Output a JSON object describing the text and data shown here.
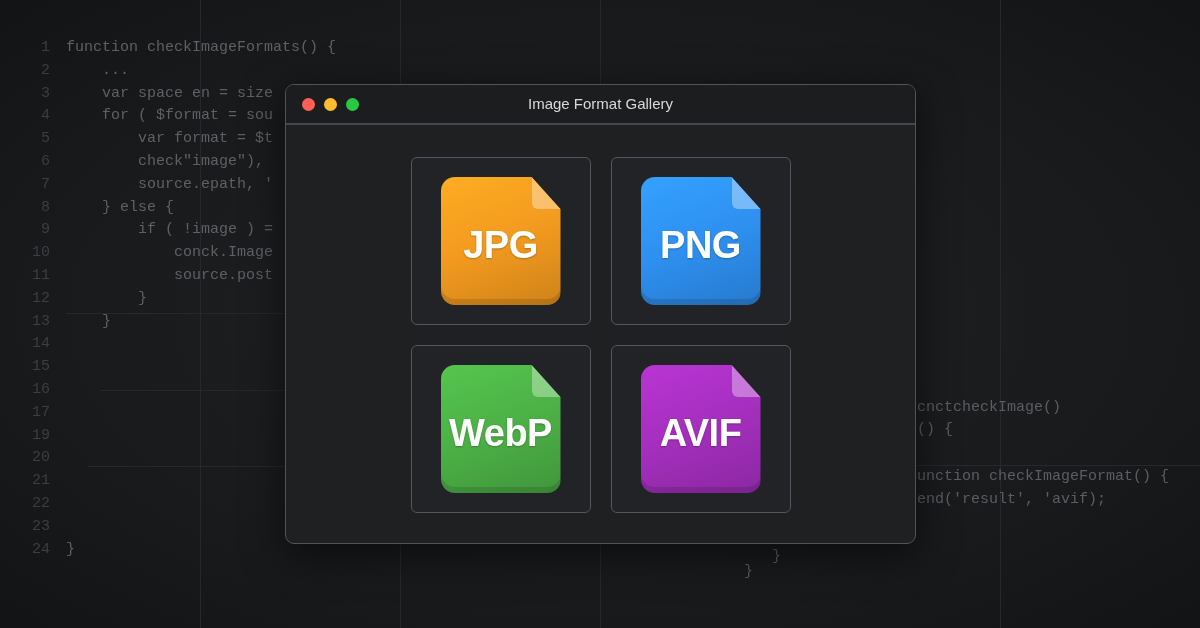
{
  "editor": {
    "lines": [
      {
        "number": "1",
        "code": "function checkImageFormats() {"
      },
      {
        "number": "2",
        "code": "    ..."
      },
      {
        "number": "3",
        "code": "    var space en = size"
      },
      {
        "number": "4",
        "code": "    for ( $format = sou"
      },
      {
        "number": "5",
        "code": "        var format = $t"
      },
      {
        "number": "6",
        "code": "        check\"image\"),"
      },
      {
        "number": "7",
        "code": "        source.epath, '"
      },
      {
        "number": "8",
        "code": "    } else {"
      },
      {
        "number": "9",
        "code": "        if ( !image ) ="
      },
      {
        "number": "10",
        "code": "            conck.Image"
      },
      {
        "number": "11",
        "code": "            source.post"
      },
      {
        "number": "12",
        "code": "        }"
      },
      {
        "number": "13",
        "code": "    }"
      },
      {
        "number": "14"
      },
      {
        "number": "15"
      },
      {
        "number": "16"
      },
      {
        "number": "17"
      },
      {
        "number": "19"
      },
      {
        "number": "20"
      },
      {
        "number": "21"
      },
      {
        "number": "22"
      },
      {
        "number": "23"
      },
      {
        "number": "24",
        "code": "}"
      }
    ],
    "fragments": [
      {
        "code": "cnctcheckImage()"
      },
      {
        "code": "() {"
      },
      {
        "code": "unction checkImageFormat() {"
      },
      {
        "code": "end('result', 'avif);"
      },
      {
        "code": "}"
      },
      {
        "code": "}"
      }
    ]
  },
  "window": {
    "title": "Image Format Gallery",
    "controls": [
      {
        "color": "#ff5f57"
      },
      {
        "color": "#febc2e"
      },
      {
        "color": "#28c840"
      }
    ],
    "tiles": [
      {
        "label": "JPG",
        "color": "#f29a1f"
      },
      {
        "label": "PNG",
        "color": "#2e90f0"
      },
      {
        "label": "WebP",
        "color": "#4cb046"
      },
      {
        "label": "AVIF",
        "color": "#a42fbd"
      }
    ]
  }
}
